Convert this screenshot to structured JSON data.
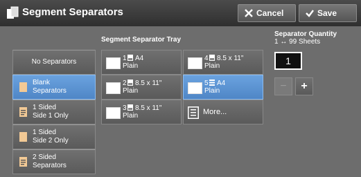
{
  "header": {
    "title": "Segment Separators",
    "cancel_label": "Cancel",
    "save_label": "Save"
  },
  "left_options": [
    {
      "line1": "No Separators",
      "line2": "",
      "selected": false,
      "icon": "none"
    },
    {
      "line1": "Blank",
      "line2": "Separators",
      "selected": true,
      "icon": "blank-page-icon"
    },
    {
      "line1": "1 Sided",
      "line2": "Side 1 Only",
      "selected": false,
      "icon": "printed-page-icon"
    },
    {
      "line1": "1 Sided",
      "line2": "Side 2 Only",
      "selected": false,
      "icon": "blank-page-icon"
    },
    {
      "line1": "2 Sided",
      "line2": "Separators",
      "selected": false,
      "icon": "printed-page-icon"
    }
  ],
  "tray_section": {
    "label": "Segment Separator Tray",
    "trays": [
      {
        "number": "1",
        "size": "A4",
        "type": "Plain",
        "selected": false
      },
      {
        "number": "4",
        "size": "8.5 x 11\"",
        "type": "Plain",
        "selected": false
      },
      {
        "number": "2",
        "size": "8.5 x 11\"",
        "type": "Plain",
        "selected": false
      },
      {
        "number": "5",
        "size": "A4",
        "type": "Plain",
        "selected": true
      },
      {
        "number": "3",
        "size": "8.5 x 11\"",
        "type": "Plain",
        "selected": false
      }
    ],
    "more_label": "More..."
  },
  "quantity": {
    "label_line1": "Separator Quantity",
    "label_line2": "1 ↔ 99 Sheets",
    "value": "1",
    "minus_label": "−",
    "plus_label": "+"
  },
  "colors": {
    "selected": "#5a92d4",
    "button": "#636363",
    "background": "#6d6d6d",
    "header": "#3a3a3a",
    "page_icon": "#f2c995"
  }
}
